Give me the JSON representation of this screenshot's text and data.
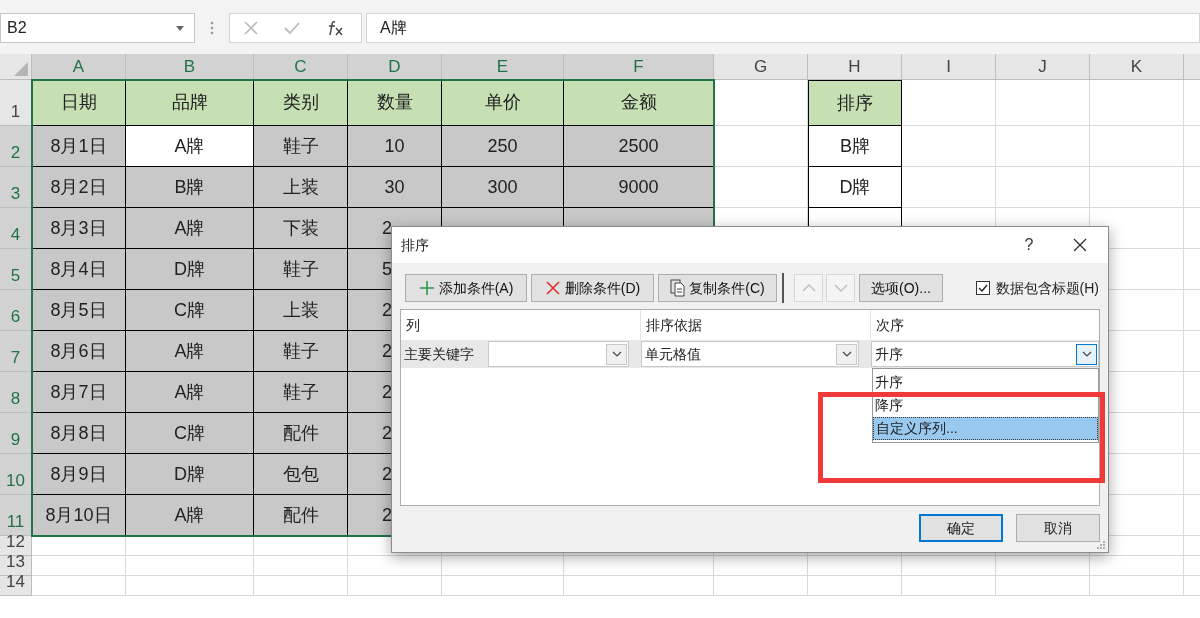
{
  "name_box": {
    "value": "B2"
  },
  "formula_bar": {
    "value": "A牌"
  },
  "sheet": {
    "column_letters": [
      "A",
      "B",
      "C",
      "D",
      "E",
      "F",
      "G",
      "H",
      "I",
      "J",
      "K"
    ],
    "header_row": {
      "number": "1",
      "cells": [
        "日期",
        "品牌",
        "类别",
        "数量",
        "单价",
        "金额"
      ]
    },
    "rows": [
      {
        "number": "2",
        "cells": [
          {
            "text": "8月1日",
            "active": false
          },
          {
            "text": "A牌",
            "active": true
          },
          {
            "text": "鞋子",
            "active": false
          },
          {
            "text": "10",
            "active": false
          },
          {
            "text": "250",
            "active": false
          },
          {
            "text": "2500",
            "active": false
          }
        ]
      },
      {
        "number": "3",
        "cells": [
          {
            "text": "8月2日",
            "active": false
          },
          {
            "text": "B牌",
            "active": false
          },
          {
            "text": "上装",
            "active": false
          },
          {
            "text": "30",
            "active": false
          },
          {
            "text": "300",
            "active": false
          },
          {
            "text": "9000",
            "active": false
          }
        ]
      },
      {
        "number": "4",
        "cells": [
          {
            "text": "8月3日",
            "active": false
          },
          {
            "text": "A牌",
            "active": false
          },
          {
            "text": "下装",
            "active": false
          },
          {
            "text": "2",
            "active": false
          }
        ]
      },
      {
        "number": "5",
        "cells": [
          {
            "text": "8月4日",
            "active": false
          },
          {
            "text": "D牌",
            "active": false
          },
          {
            "text": "鞋子",
            "active": false
          },
          {
            "text": "5",
            "active": false
          }
        ]
      },
      {
        "number": "6",
        "cells": [
          {
            "text": "8月5日",
            "active": false
          },
          {
            "text": "C牌",
            "active": false
          },
          {
            "text": "上装",
            "active": false
          },
          {
            "text": "2",
            "active": false
          }
        ]
      },
      {
        "number": "7",
        "cells": [
          {
            "text": "8月6日",
            "active": false
          },
          {
            "text": "A牌",
            "active": false
          },
          {
            "text": "鞋子",
            "active": false
          },
          {
            "text": "2",
            "active": false
          }
        ]
      },
      {
        "number": "8",
        "cells": [
          {
            "text": "8月7日",
            "active": false
          },
          {
            "text": "A牌",
            "active": false
          },
          {
            "text": "鞋子",
            "active": false
          },
          {
            "text": "2",
            "active": false
          }
        ]
      },
      {
        "number": "9",
        "cells": [
          {
            "text": "8月8日",
            "active": false
          },
          {
            "text": "C牌",
            "active": false
          },
          {
            "text": "配件",
            "active": false
          },
          {
            "text": "2",
            "active": false
          }
        ]
      },
      {
        "number": "10",
        "cells": [
          {
            "text": "8月9日",
            "active": false
          },
          {
            "text": "D牌",
            "active": false
          },
          {
            "text": "包包",
            "active": false
          },
          {
            "text": "2",
            "active": false
          }
        ]
      },
      {
        "number": "11",
        "cells": [
          {
            "text": "8月10日",
            "active": false
          },
          {
            "text": "A牌",
            "active": false
          },
          {
            "text": "配件",
            "active": false
          },
          {
            "text": "2",
            "active": false
          }
        ]
      }
    ],
    "extra_rows": [
      "12",
      "13",
      "14"
    ],
    "side_list": {
      "header": "排序",
      "items": [
        "B牌",
        "D牌"
      ]
    }
  },
  "sort_dialog": {
    "title": "排序",
    "help": "?",
    "toolbar": [
      {
        "kind": "add",
        "label": "添加条件(A)",
        "disabled": false
      },
      {
        "kind": "delete",
        "label": "删除条件(D)",
        "disabled": false
      },
      {
        "kind": "copy",
        "label": "复制条件(C)",
        "disabled": false
      },
      {
        "kind": "up",
        "disabled": true
      },
      {
        "kind": "down",
        "disabled": true
      },
      {
        "kind": "options",
        "label": "选项(O)...",
        "disabled": false
      }
    ],
    "header_checkbox": {
      "label": "数据包含标题(H)",
      "checked": true
    },
    "columns": [
      "列",
      "排序依据",
      "次序"
    ],
    "level": {
      "label": "主要关键字",
      "sort_on": "单元格值",
      "order": "升序"
    },
    "order_options": [
      {
        "label": "升序",
        "selected": false
      },
      {
        "label": "降序",
        "selected": false
      },
      {
        "label": "自定义序列...",
        "selected": true
      }
    ],
    "buttons": [
      {
        "label": "确定",
        "default": true
      },
      {
        "label": "取消",
        "default": false
      }
    ]
  }
}
